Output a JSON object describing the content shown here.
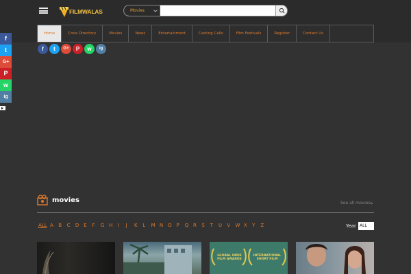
{
  "logo": {
    "text": "FILMWALAS"
  },
  "search": {
    "category": "Movies",
    "query": ""
  },
  "nav": {
    "items": [
      {
        "label": "Home",
        "active": true
      },
      {
        "label": "Crew Directory"
      },
      {
        "label": "Movies"
      },
      {
        "label": "News"
      },
      {
        "label": "Entertainment"
      },
      {
        "label": "Casting Calls"
      },
      {
        "label": "Film Festivals"
      },
      {
        "label": "Register"
      },
      {
        "label": "Contact Us"
      }
    ]
  },
  "social": [
    {
      "name": "facebook-icon",
      "glyph": "f",
      "color": "#3b5998"
    },
    {
      "name": "twitter-icon",
      "glyph": "t",
      "color": "#1da1f2"
    },
    {
      "name": "google-plus-icon",
      "glyph": "G+",
      "color": "#dd4b39"
    },
    {
      "name": "pinterest-icon",
      "glyph": "P",
      "color": "#cb2027"
    },
    {
      "name": "whatsapp-icon",
      "glyph": "w",
      "color": "#25d366"
    },
    {
      "name": "instagram-icon",
      "glyph": "ig",
      "color": "#517fa4"
    }
  ],
  "share_bar": [
    {
      "name": "facebook-icon",
      "glyph": "f",
      "color": "#3b5998"
    },
    {
      "name": "twitter-icon",
      "glyph": "t",
      "color": "#1da1f2"
    },
    {
      "name": "google-plus-icon",
      "glyph": "G+",
      "color": "#dd4b39"
    },
    {
      "name": "pinterest-icon",
      "glyph": "P",
      "color": "#cb2027"
    },
    {
      "name": "whatsapp-icon",
      "glyph": "w",
      "color": "#25d366"
    },
    {
      "name": "instagram-icon",
      "glyph": "ig",
      "color": "#517fa4"
    }
  ],
  "movies_section": {
    "title": "movies",
    "see_all": "See all movies",
    "letters": [
      "ALL",
      "A",
      "B",
      "C",
      "D",
      "E",
      "F",
      "G",
      "H",
      "I",
      "J",
      "K",
      "L",
      "M",
      "N",
      "O",
      "P",
      "Q",
      "R",
      "S",
      "T",
      "U",
      "V",
      "W",
      "X",
      "Y",
      "Z"
    ],
    "year_label": "Year",
    "year_value": "ALL",
    "poster_texts": {
      "festival_1": "GLOBAL INDIE\nFILM AWARDS",
      "festival_2": "INTERNATIONAL\nSHORT FILM"
    }
  },
  "colors": {
    "accent": "#e07a2a",
    "background": "#323232",
    "header": "#2b2b2b"
  }
}
